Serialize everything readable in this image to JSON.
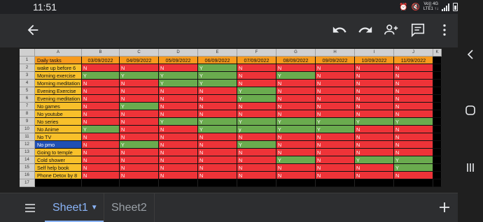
{
  "status_bar": {
    "time": "11:51",
    "network_top": "Vo)) 4G",
    "network_bottom": "LTE1 ↑↓"
  },
  "toolbar": {
    "icons": [
      "back-arrow-icon",
      "undo-icon",
      "redo-icon",
      "add-person-icon",
      "comment-icon",
      "more-vert-icon"
    ]
  },
  "sheet": {
    "columns": [
      "A",
      "B",
      "C",
      "D",
      "E",
      "F",
      "G",
      "H",
      "I",
      "J",
      "K"
    ],
    "header_row": {
      "task_label": "Daily tasks",
      "dates": [
        "03/09/2022",
        "04/09/2022",
        "05/09/2022",
        "06/09/2022",
        "07/09/2022",
        "08/09/2022",
        "09/09/2022",
        "10/09/2022",
        "11/09/2022"
      ]
    },
    "rows": [
      {
        "num": "2",
        "task": "wake up before 6",
        "values": [
          "N",
          "N",
          "N",
          "Y",
          "N",
          "N",
          "N",
          "N",
          "N"
        ]
      },
      {
        "num": "3",
        "task": "Morning exercise",
        "values": [
          "Y",
          "Y",
          "Y",
          "Y",
          "N",
          "Y",
          "N",
          "N",
          "N"
        ]
      },
      {
        "num": "4",
        "task": "Morning meditation",
        "values": [
          "N",
          "N",
          "Y",
          "Y",
          "N",
          "N",
          "N",
          "N",
          "N"
        ]
      },
      {
        "num": "5",
        "task": "Evening Exercise",
        "values": [
          "N",
          "N",
          "N",
          "N",
          "Y",
          "N",
          "N",
          "N",
          "N"
        ]
      },
      {
        "num": "6",
        "task": "Evening meditation",
        "values": [
          "N",
          "N",
          "N",
          "N",
          "Y",
          "N",
          "N",
          "N",
          "N"
        ]
      },
      {
        "num": "7",
        "task": "No games",
        "values": [
          "N",
          "Y",
          "N",
          "N",
          "N",
          "N",
          "N",
          "N",
          "N"
        ]
      },
      {
        "num": "8",
        "task": "No youtube",
        "values": [
          "N",
          "N",
          "N",
          "N",
          "N",
          "N",
          "N",
          "N",
          "N"
        ]
      },
      {
        "num": "9",
        "task": "No series",
        "values": [
          "N",
          "N",
          "Y",
          "Y",
          "Y",
          "Y",
          "Y",
          "Y",
          "Y"
        ]
      },
      {
        "num": "10",
        "task": "No Anime",
        "values": [
          "Y",
          "N",
          "N",
          "Y",
          "y",
          "Y",
          "Y",
          "N",
          "N"
        ]
      },
      {
        "num": "11",
        "task": "No TV",
        "values": [
          "N",
          "N",
          "N",
          "N",
          "N",
          "N",
          "N",
          "N",
          "N"
        ]
      },
      {
        "num": "12",
        "task": "No pmo",
        "values": [
          "N",
          "Y",
          "N",
          "N",
          "Y",
          "N",
          "N",
          "N",
          "N"
        ]
      },
      {
        "num": "13",
        "task": "Going to temple",
        "values": [
          "N",
          "N",
          "N",
          "N",
          "N",
          "N",
          "N",
          "N",
          "N"
        ]
      },
      {
        "num": "14",
        "task": "Cold shower",
        "values": [
          "N",
          "N",
          "N",
          "N",
          "N",
          "Y",
          "N",
          "Y",
          "Y"
        ]
      },
      {
        "num": "15",
        "task": "Self help book",
        "values": [
          "N",
          "N",
          "N",
          "N",
          "N",
          "N",
          "N",
          "N",
          "Y"
        ]
      },
      {
        "num": "16",
        "task": "Phone Detox by 8",
        "values": [
          "N",
          "N",
          "N",
          "N",
          "N",
          "N",
          "N",
          "N",
          "N"
        ]
      }
    ],
    "empty_row_num": "17",
    "selected_row": "12"
  },
  "tabs": [
    {
      "label": "Sheet1",
      "active": true
    },
    {
      "label": "Sheet2",
      "active": false
    }
  ],
  "colors": {
    "no": "#ee3338",
    "yes": "#6aab4e",
    "task_col": "#f8c02a",
    "header": "#f79a1d",
    "selected": "#1f4fb3",
    "accent": "#8ab4f8"
  }
}
